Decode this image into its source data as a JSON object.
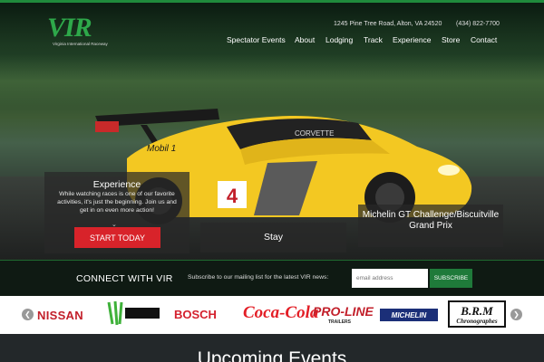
{
  "brand": {
    "logo_text": "VIR",
    "logo_sub": "Virginia International Raceway",
    "accent": "#1f8a3c"
  },
  "header": {
    "address": "1245 Pine Tree Road, Alton, VA 24520",
    "phone": "(434) 822-7700",
    "nav": [
      "Spectator Events",
      "About",
      "Lodging",
      "Track",
      "Experience",
      "Store",
      "Contact"
    ]
  },
  "hero": {
    "car_number": "4",
    "car_brand": "CORVETTE",
    "car_sponsor": "Mobil 1",
    "experience": {
      "title": "Experience",
      "description": "While watching races is one of our favorite activities, it's just the beginning. Join us and get in on even more action!",
      "cta": "START TODAY"
    },
    "stay": {
      "title": "Stay"
    },
    "michelin": {
      "title": "Michelin GT Challenge/Biscuitville Grand Prix"
    }
  },
  "connect": {
    "title": "CONNECT WITH VIR",
    "text": "Subscribe to our mailing list for the latest VIR news:",
    "email_placeholder": "email address",
    "button": "SUBSCRIBE"
  },
  "sponsors": {
    "items": [
      "NISSAN",
      "MONSTER ENERGY",
      "BOSCH",
      "Coca-Cola",
      "PRO-LINE",
      "MICHELIN",
      "B.R.M"
    ],
    "proline_sub": "TRAILERS",
    "brm_sub": "Chronographes",
    "prev_icon": "chevron-left-icon",
    "next_icon": "chevron-right-icon"
  },
  "upcoming": {
    "title": "Upcoming Events"
  }
}
